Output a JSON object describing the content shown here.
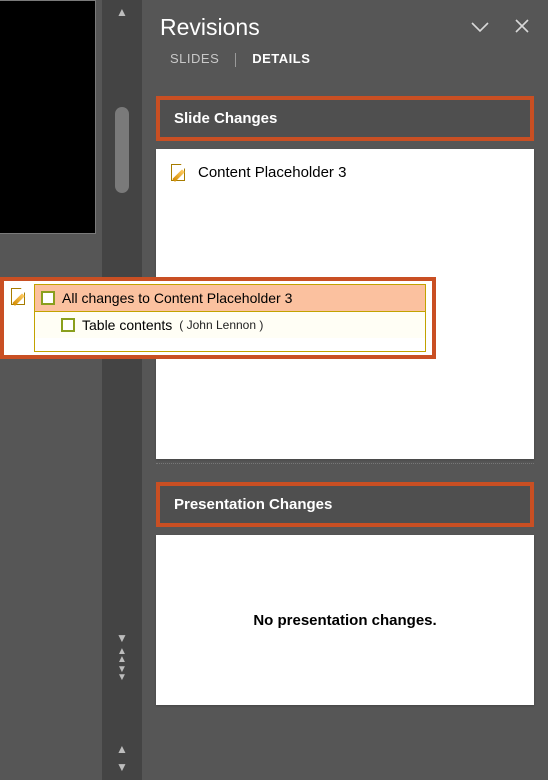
{
  "panel": {
    "title": "Revisions",
    "tabs": {
      "slides": "SLIDES",
      "details": "DETAILS"
    }
  },
  "sections": {
    "slide_changes": "Slide Changes",
    "presentation_changes": "Presentation Changes"
  },
  "slide_item": {
    "label": "Content Placeholder 3"
  },
  "popup": {
    "all_changes": "All changes to Content Placeholder 3",
    "table_contents": "Table contents",
    "author": "( John Lennon )"
  },
  "messages": {
    "no_presentation_changes": "No presentation changes."
  }
}
